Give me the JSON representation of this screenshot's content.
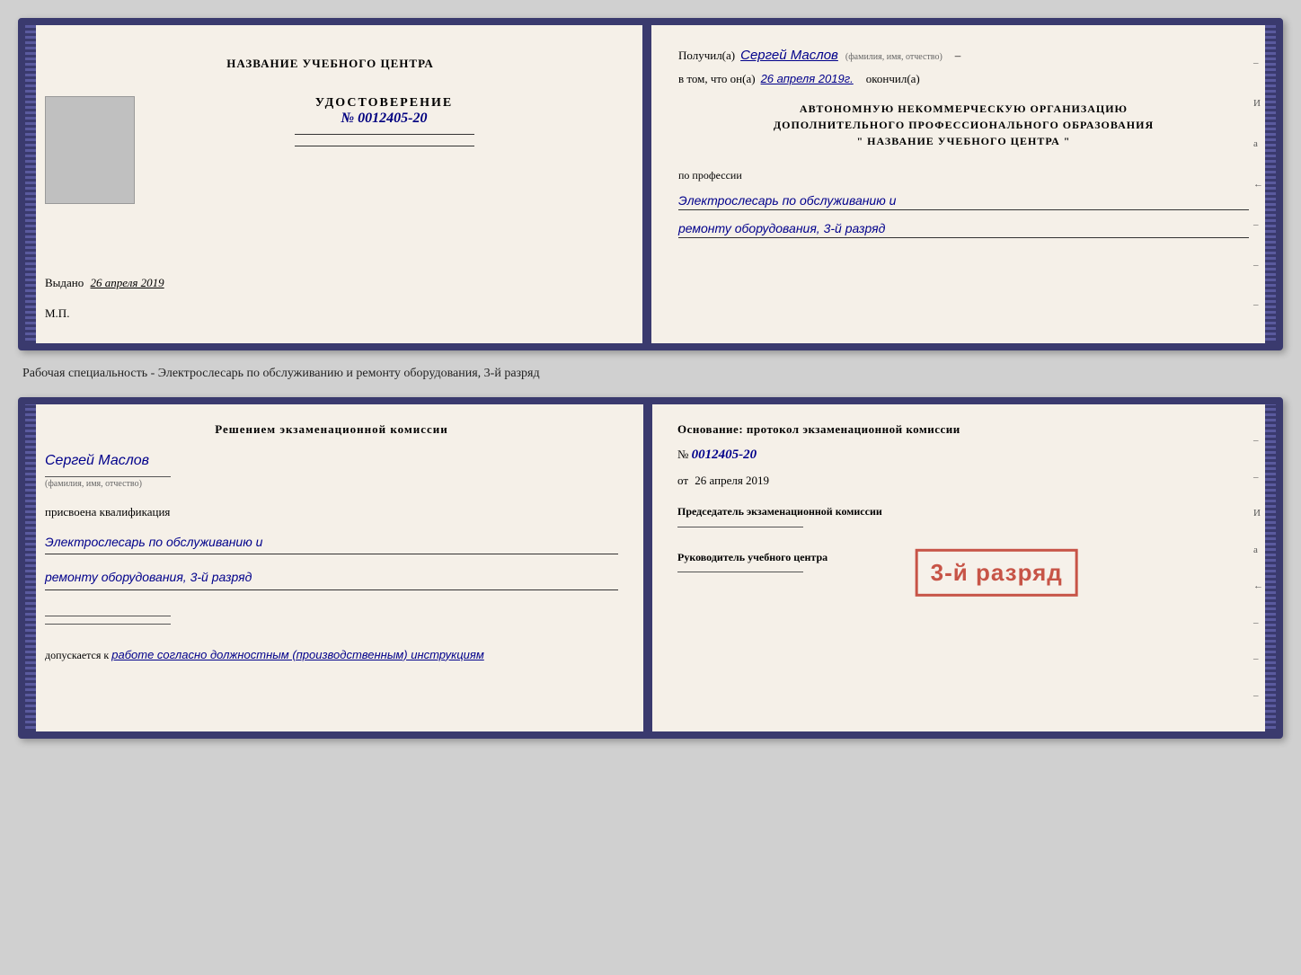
{
  "top_cert": {
    "left": {
      "title": "НАЗВАНИЕ УЧЕБНОГО ЦЕНТРА",
      "udostoverenie_label": "УДОСТОВЕРЕНИЕ",
      "number": "№ 0012405-20",
      "vydano": "Выдано",
      "vydano_date": "26 апреля 2019",
      "mp": "М.П."
    },
    "right": {
      "poluchil": "Получил(а)",
      "name_handwritten": "Сергей Маслов",
      "name_hint": "(фамилия, имя, отчество)",
      "dash": "–",
      "vtom": "в том, что он(а)",
      "date_handwritten": "26 апреля 2019г.",
      "okonchil": "окончил(а)",
      "org_line1": "АВТОНОМНУЮ НЕКОММЕРЧЕСКУЮ ОРГАНИЗАЦИЮ",
      "org_line2": "ДОПОЛНИТЕЛЬНОГО ПРОФЕССИОНАЛЬНОГО ОБРАЗОВАНИЯ",
      "org_line3": "\"    НАЗВАНИЕ УЧЕБНОГО ЦЕНТРА    \"",
      "po_professii": "по профессии",
      "profession_hw1": "Электрослесарь по обслуживанию и",
      "profession_hw2": "ремонту оборудования, 3-й разряд",
      "edge_marks": [
        "И",
        "а",
        "←",
        "–",
        "–",
        "–",
        "–"
      ]
    }
  },
  "specialty_label": "Рабочая специальность - Электрослесарь по обслуживанию и ремонту оборудования, 3-й разряд",
  "bottom_cert": {
    "left": {
      "resheniem": "Решением экзаменационной комиссии",
      "name_hw": "Сергей Маслов",
      "name_hint": "(фамилия, имя, отчество)",
      "prisvoena": "присвоена квалификация",
      "qual_hw1": "Электрослесарь по обслуживанию и",
      "qual_hw2": "ремонту оборудования, 3-й разряд",
      "dopuskaetsya": "допускается к",
      "dopusk_hw": "работе согласно должностным (производственным) инструкциям"
    },
    "right": {
      "osnovanie": "Основание: протокол экзаменационной комиссии",
      "protocol_label": "№",
      "protocol_number": "0012405-20",
      "ot_label": "от",
      "ot_date": "26 апреля 2019",
      "predsedatel": "Председатель экзаменационной комиссии",
      "rukovoditel": "Руководитель учебного центра",
      "stamp": "3-й разряд",
      "edge_marks": [
        "–",
        "–",
        "И",
        "а",
        "←",
        "–",
        "–",
        "–"
      ]
    }
  }
}
